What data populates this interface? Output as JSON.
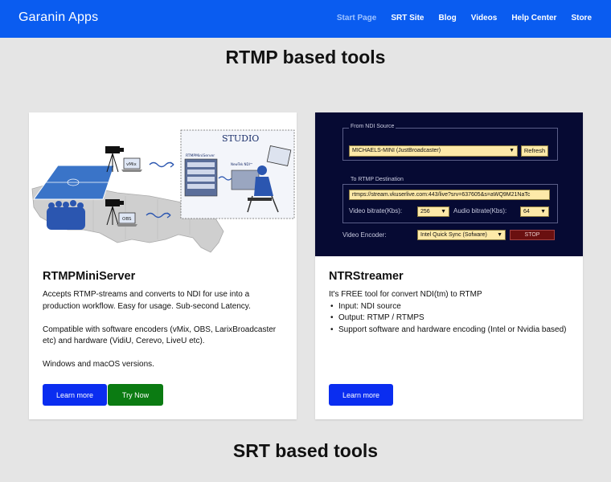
{
  "nav": {
    "brand": "Garanin Apps",
    "links": [
      "Start Page",
      "SRT Site",
      "Blog",
      "Videos",
      "Help Center",
      "Store"
    ],
    "active_index": 0,
    "active_color": "#9fc3ff"
  },
  "sections": {
    "rtmp_title": "RTMP based tools",
    "srt_title": "SRT based tools"
  },
  "cards": [
    {
      "title": "RTMPMiniServer",
      "paragraphs": [
        "Accepts RTMP-streams and converts to NDI for use into a production workflow. Easy for usage. Sub-second Latency.",
        "Compatible with software encoders (vMix, OBS, LarixBroadcaster etc) and hardware (VidiU, Cerevo, LiveU etc).",
        "Windows and macOS versions."
      ],
      "image_labels": {
        "studio": "STUDIO",
        "server": "RTMPMiniServer",
        "vmix": "vMix",
        "obs": "OBS",
        "newtek": "NewTek NDI™"
      },
      "buttons": [
        "Learn more",
        "Try Now"
      ]
    },
    {
      "title": "NTRStreamer",
      "intro": "It's FREE tool for convert NDI(tm) to RTMP",
      "bullets": [
        "Input: NDI source",
        "Output: RTMP / RTMPS",
        "Support software and hardware encoding (Intel or Nvidia based)"
      ],
      "buttons": [
        "Learn more"
      ],
      "screenshot": {
        "ndi_group_label": "From NDI Source",
        "ndi_source": "MICHAELS-MINI (JustBroadcaster)",
        "refresh": "Refresh",
        "rtmp_group_label": "To RTMP Destination",
        "rtmp_url": "rtmps://stream.vkuserlive.com:443/live?srv=637605&s=aWQ9M21NaTc",
        "video_bitrate_label": "Video bitrate(Kbs):",
        "video_bitrate": "256",
        "audio_bitrate_label": "Audio bitrate(Kbs):",
        "audio_bitrate": "64",
        "encoder_label": "Video Encoder:",
        "encoder": "Intel Quick Sync (Sofware)",
        "stop": "STOP"
      }
    }
  ],
  "colors": {
    "navbar": "#0a5cf0",
    "page_bg": "#e5e5e5",
    "button_blue": "#0a2df0",
    "button_green": "#0b7b12"
  }
}
